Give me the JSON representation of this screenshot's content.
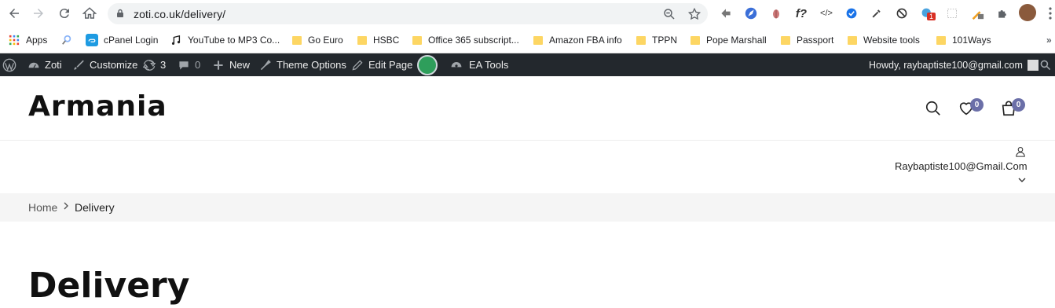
{
  "browser": {
    "url": "zoti.co.uk/delivery/",
    "extension_badge": "1"
  },
  "bookmarks": [
    {
      "label": "Apps",
      "icon": "apps-grid-icon"
    },
    {
      "label": "",
      "icon": "search-bookmark-icon"
    },
    {
      "label": "cPanel Login",
      "icon": "cpanel-icon"
    },
    {
      "label": "YouTube to MP3 Co...",
      "icon": "music-note-icon"
    },
    {
      "label": "Go Euro",
      "icon": "folder-icon"
    },
    {
      "label": "HSBC",
      "icon": "folder-icon"
    },
    {
      "label": "Office 365 subscript...",
      "icon": "folder-icon"
    },
    {
      "label": "Amazon FBA info",
      "icon": "folder-icon"
    },
    {
      "label": "TPPN",
      "icon": "folder-icon"
    },
    {
      "label": "Pope Marshall",
      "icon": "folder-icon"
    },
    {
      "label": "Passport",
      "icon": "folder-icon"
    },
    {
      "label": "Website tools",
      "icon": "folder-icon"
    },
    {
      "label": "101Ways",
      "icon": "folder-icon"
    }
  ],
  "adminbar": {
    "site": "Zoti",
    "customize": "Customize",
    "updates_count": "3",
    "comments_count": "0",
    "new": "New",
    "theme_options": "Theme Options",
    "edit_page": "Edit Page",
    "ea_tools": "EA Tools",
    "howdy": "Howdy, raybaptiste100@gmail.com"
  },
  "site": {
    "logo": "Armania",
    "wishlist_count": "0",
    "cart_count": "0",
    "account_email": "Raybaptiste100@Gmail.Com",
    "badge_color": "#6b6fa8"
  },
  "breadcrumb": {
    "home": "Home",
    "current": "Delivery"
  },
  "page": {
    "title": "Delivery"
  }
}
